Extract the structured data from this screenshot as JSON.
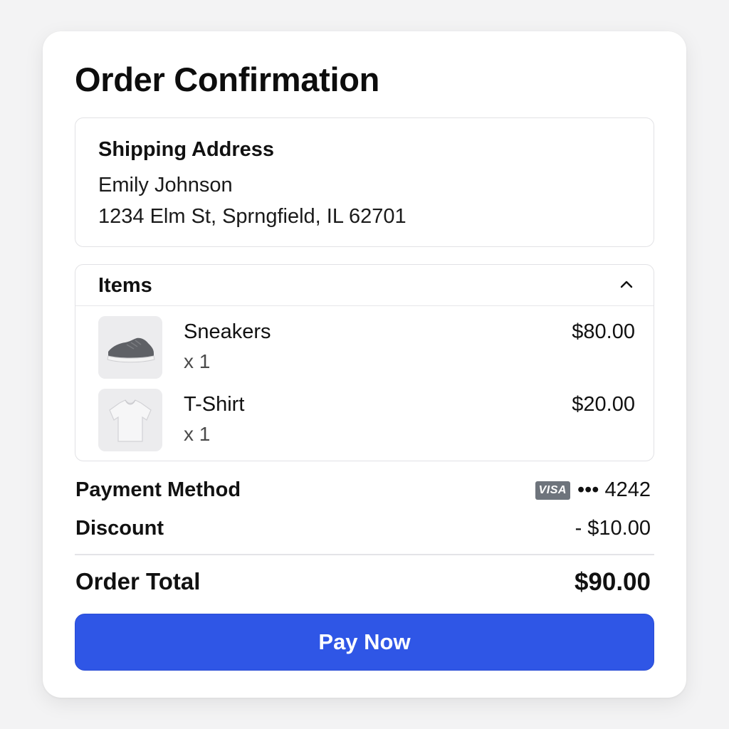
{
  "page": {
    "title": "Order Confirmation"
  },
  "shipping": {
    "heading": "Shipping Address",
    "name": "Emily Johnson",
    "address": "1234 Elm St, Sprngfield, IL 62701"
  },
  "items": {
    "heading": "Items",
    "collapse_icon": "chevron-up-icon",
    "list": [
      {
        "name": "Sneakers",
        "qty": "x 1",
        "price": "$80.00",
        "image": "sneaker-image"
      },
      {
        "name": "T-Shirt",
        "qty": "x 1",
        "price": "$20.00",
        "image": "tshirt-image"
      }
    ]
  },
  "payment": {
    "label": "Payment Method",
    "card_brand": "VISA",
    "card_masked": "••• 4242"
  },
  "discount": {
    "label": "Discount",
    "value": "- $10.00"
  },
  "total": {
    "label": "Order Total",
    "value": "$90.00"
  },
  "actions": {
    "pay_label": "Pay Now"
  },
  "colors": {
    "accent": "#2f56e6",
    "card_bg": "#ffffff",
    "page_bg": "#f3f3f4"
  }
}
